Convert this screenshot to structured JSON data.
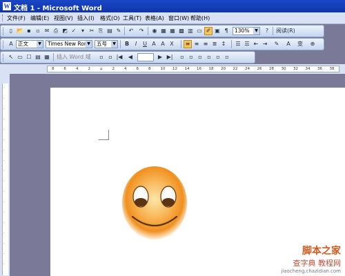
{
  "window": {
    "title": "文档 1 - Microsoft Word",
    "app_icon": "W"
  },
  "menubar": {
    "items": [
      "文件(F)",
      "编辑(E)",
      "视图(V)",
      "插入(I)",
      "格式(O)",
      "工具(T)",
      "表格(A)",
      "窗口(W)",
      "帮助(H)"
    ]
  },
  "standard_toolbar": {
    "zoom": "130%",
    "read_label": "阅读(R)"
  },
  "format_toolbar": {
    "style": "正文",
    "font": "Times New Roman",
    "size": "五号"
  },
  "drawing_toolbar": {
    "insert_wordart": "插入 Word 域"
  },
  "ruler": {
    "ticks": [
      "8",
      "6",
      "4",
      "2",
      "",
      "2",
      "4",
      "6",
      "8",
      "10",
      "12",
      "14",
      "16",
      "18",
      "20",
      "22",
      "24",
      "26",
      "28",
      "30",
      "32",
      "34",
      "36",
      "38"
    ]
  },
  "watermark": {
    "line1": "脚本之家",
    "line2": "查字典 教程网",
    "line3": "jiaocheng.chazidian.com"
  },
  "colors": {
    "title_bg": "#1a47c7",
    "toolbar_bg": "#c5d5f0",
    "active_btn": "#f7c55a",
    "canvas_bg": "#7a7a98"
  }
}
